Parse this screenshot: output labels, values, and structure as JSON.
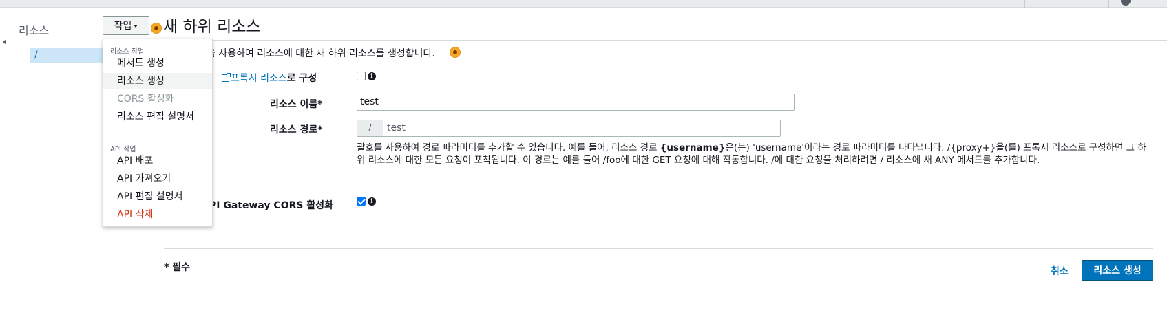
{
  "sidebar": {
    "title": "리소스",
    "tree_root": "/",
    "actions_button": "작업"
  },
  "menu": {
    "group1_label": "리소스 작업",
    "group1_items": [
      "메서드 생성",
      "리소스 생성",
      "CORS 활성화",
      "리소스 편집 설명서"
    ],
    "group2_label": "API 작업",
    "group2_items": [
      "API 배포",
      "API 가져오기",
      "API 편집 설명서",
      "API 삭제"
    ]
  },
  "page": {
    "title": "새 하위 리소스",
    "description": "을 사용하여 리소스에 대한 새 하위 리소스를 생성합니다."
  },
  "form": {
    "proxy_link": "프록시 리소스",
    "proxy_suffix": "로 구성",
    "proxy_checked": false,
    "name_label": "리소스 이름*",
    "name_value": "test",
    "path_label": "리소스 경로*",
    "path_prefix": "/",
    "path_value": "test",
    "help_part1": "괄호를 사용하여 경로 파라미터를 추가할 수 있습니다. 예를 들어, 리소스 경로 ",
    "help_bold": "{username}",
    "help_part2": "은(는) 'username'이라는 경로 파라미터를 나타냅니다. /{proxy+}을(를) 프록시 리소스로 구성하면 그 하위 리소스에 대한 모든 요청이 포착됩니다. 이 경로는 예를 들어 /foo에 대한 GET 요청에 대해 작동합니다. /에 대한 요청을 처리하려면 / 리소스에 새 ANY 메서드를 추가합니다.",
    "cors_label": "PI Gateway CORS 활성화",
    "cors_checked": true
  },
  "footer": {
    "required_note": "* 필수",
    "cancel": "취소",
    "create": "리소스 생성"
  },
  "icons": {
    "info": "info-icon",
    "external": "external-link-icon",
    "caret": "caret-down-icon"
  },
  "colors": {
    "link": "#0073bb",
    "primary": "#0073bb",
    "danger": "#d13212",
    "selected_bg": "#cce6f7",
    "tutorial_dot": "#f7a823"
  }
}
